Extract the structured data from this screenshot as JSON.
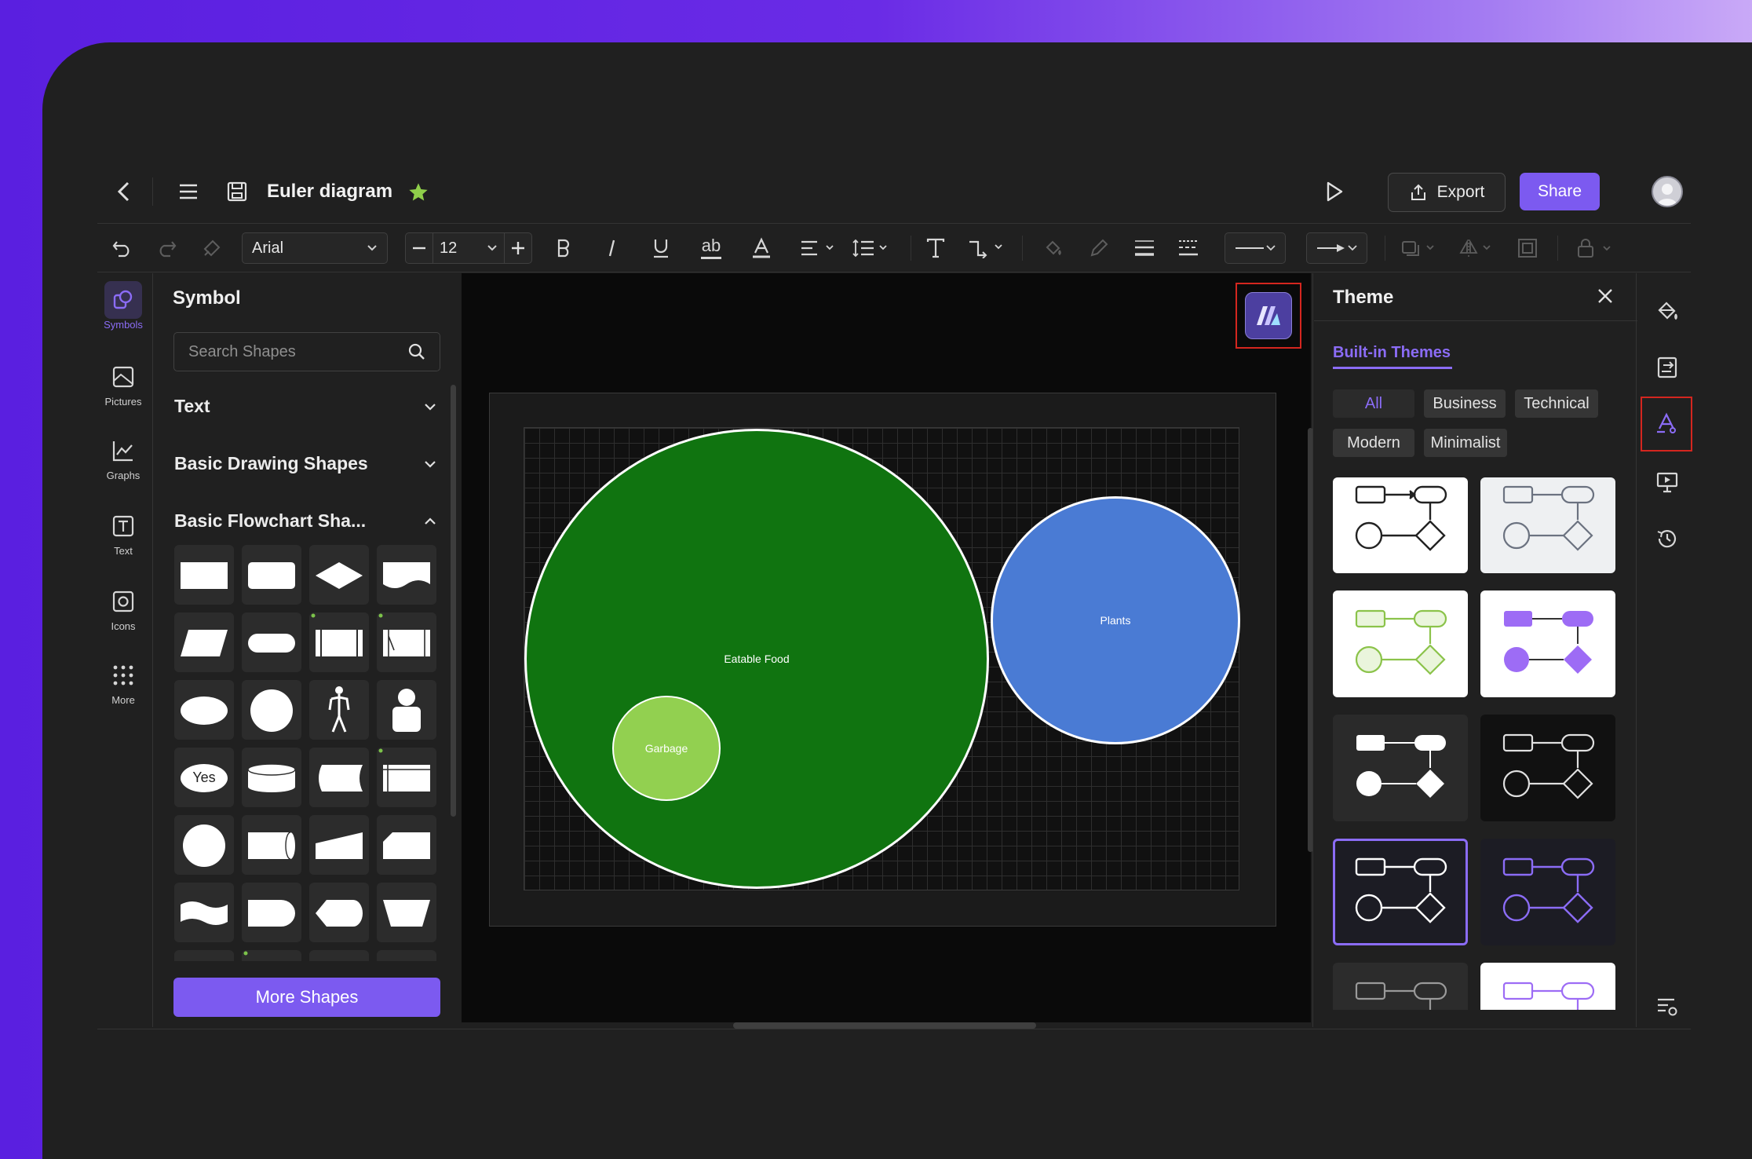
{
  "header": {
    "doc_title": "Euler diagram",
    "export_label": "Export",
    "share_label": "Share"
  },
  "toolbar": {
    "font_family": "Arial",
    "font_size": "12",
    "strikethrough_label": "ab"
  },
  "left_rail": {
    "items": [
      {
        "label": "Symbols",
        "icon": "symbols-icon",
        "active": true
      },
      {
        "label": "Pictures",
        "icon": "pictures-icon"
      },
      {
        "label": "Graphs",
        "icon": "graphs-icon"
      },
      {
        "label": "Text",
        "icon": "text-icon"
      },
      {
        "label": "Icons",
        "icon": "icons-icon"
      },
      {
        "label": "More",
        "icon": "more-icon"
      }
    ]
  },
  "symbol_panel": {
    "title": "Symbol",
    "search_placeholder": "Search Shapes",
    "sections": [
      {
        "label": "Text",
        "expanded": false
      },
      {
        "label": "Basic Drawing Shapes",
        "expanded": false
      },
      {
        "label": "Basic Flowchart Sha...",
        "expanded": true
      }
    ],
    "yes_shape_label": "Yes",
    "more_shapes_label": "More Shapes"
  },
  "canvas": {
    "shapes": [
      {
        "label": "Eatable Food",
        "color": "#107410"
      },
      {
        "label": "Garbage",
        "color": "#92d050"
      },
      {
        "label": "Plants",
        "color": "#4a7bd4"
      }
    ]
  },
  "theme_panel": {
    "title": "Theme",
    "tab_label": "Built-in Themes",
    "filters": [
      {
        "label": "All",
        "active": true
      },
      {
        "label": "Business"
      },
      {
        "label": "Technical"
      },
      {
        "label": "Modern"
      },
      {
        "label": "Minimalist"
      }
    ]
  },
  "colors": {
    "accent": "#7c5af0",
    "highlight_box": "#d4261f",
    "background": "#202020"
  }
}
